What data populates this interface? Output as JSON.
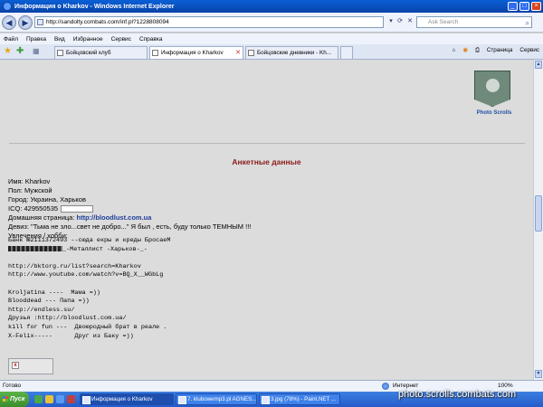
{
  "window": {
    "title": "Информация о Kharkov - Windows Internet Explorer",
    "minimize_label": "_",
    "maximize_label": "□",
    "close_label": "×"
  },
  "address_bar": {
    "url": "http://sandolty.combats.com/inf.pl?1228808094",
    "search_placeholder": "Ask Search"
  },
  "menu": [
    "Файл",
    "Правка",
    "Вид",
    "Избранное",
    "Сервис",
    "Справка"
  ],
  "tabs": [
    {
      "label": "Бойцовский клуб",
      "active": false
    },
    {
      "label": "Информация о Kharkov",
      "active": true
    },
    {
      "label": "Бойцовские дневники - Kh...",
      "active": false
    }
  ],
  "command_bar": {
    "page": "Страница",
    "tools": "Сервис"
  },
  "photo_scrolls": {
    "caption": "Photo Scrolls"
  },
  "page": {
    "heading": "Анкетные данные",
    "name": "Имя: Kharkov",
    "gender": "Пол: Мужской",
    "city": "Город: Украина, Харьков",
    "icq": "ICQ: 429550535",
    "homepage_label": "Домашняя страница:",
    "homepage_link": "http://bloodlust.com.ua",
    "motto": "Девиз: \"Тьма не зло...свет не добро...\" Я был , есть, буду только ТЕМНЫМ !!!",
    "hobbies_label": "Увлечения / хобби:",
    "hobby_lines": [
      "Банк №2111372493 --сюда екры и креды БросаеМ",
      "_-Металлист -Харьков-_-",
      "",
      "http://bktorg.ru/list?search=Kharkov",
      "http://www.youtube.com/watch?v=BQ_X__WGbLg",
      "",
      "Kroljatina ----  Мама =))",
      "Blooddead --- Папа =))",
      "http://endless.su/",
      "Друзья :http://bloodlust.com.ua/",
      "kill for fun ---  Двоюродный брат в реале .",
      "X-Felix-----      Друг из Баку =))"
    ]
  },
  "status_bar": {
    "status": "Готово",
    "zone": "Интернет",
    "zoom": "100%"
  },
  "taskbar": {
    "start": "Пуск",
    "tasks": [
      {
        "label": "Информация о Kharkov",
        "active": true
      },
      {
        "label": "7. klubowemp3.pl AGNES...",
        "active": false
      },
      {
        "label": "3.jpg (78%) - Paint.NET ...",
        "active": false
      }
    ]
  },
  "watermark": "photo.scrolls.combats.com"
}
